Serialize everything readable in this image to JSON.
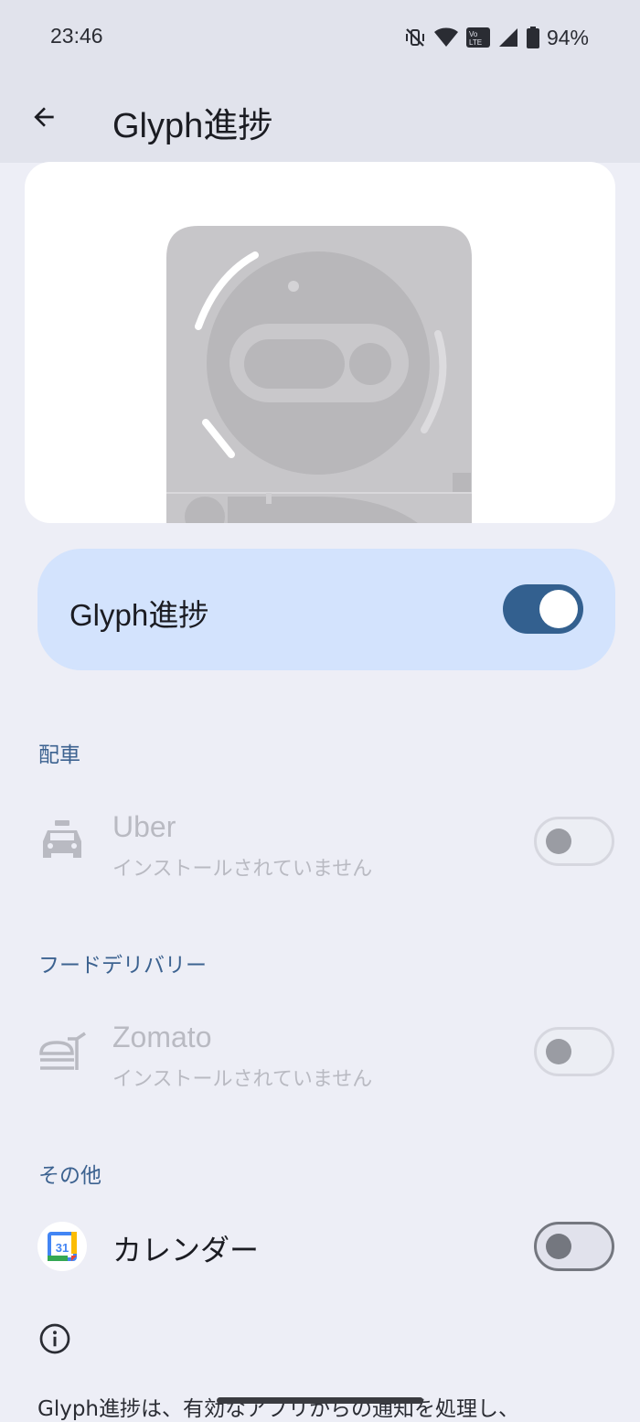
{
  "status_bar": {
    "time": "23:46",
    "battery": "94%",
    "icons": [
      "mute-vibrate-icon",
      "wifi-icon",
      "volte-icon",
      "signal-icon",
      "battery-icon"
    ]
  },
  "app_bar": {
    "title": "Glyph進捗",
    "back_icon": "arrow-back-icon"
  },
  "master": {
    "label": "Glyph進捗",
    "enabled": true
  },
  "sections": [
    {
      "header": "配車",
      "items": [
        {
          "title": "Uber",
          "subtitle": "インストールされていません",
          "icon": "car-icon",
          "enabled": false,
          "disabled": true
        }
      ]
    },
    {
      "header": "フードデリバリー",
      "items": [
        {
          "title": "Zomato",
          "subtitle": "インストールされていません",
          "icon": "food-delivery-icon",
          "enabled": false,
          "disabled": true
        }
      ]
    },
    {
      "header": "その他",
      "items": [
        {
          "title": "カレンダー",
          "icon": "calendar-app-icon",
          "icon_text": "31",
          "enabled": false,
          "disabled": false
        }
      ]
    }
  ],
  "info": {
    "icon": "info-icon",
    "text": "Glyph進捗は、有効なアプリからの通知を処理し、"
  },
  "colors": {
    "accent": "#33608f",
    "section_header": "#3c6290",
    "master_bg": "#d3e3fd",
    "background": "#edeef6"
  }
}
